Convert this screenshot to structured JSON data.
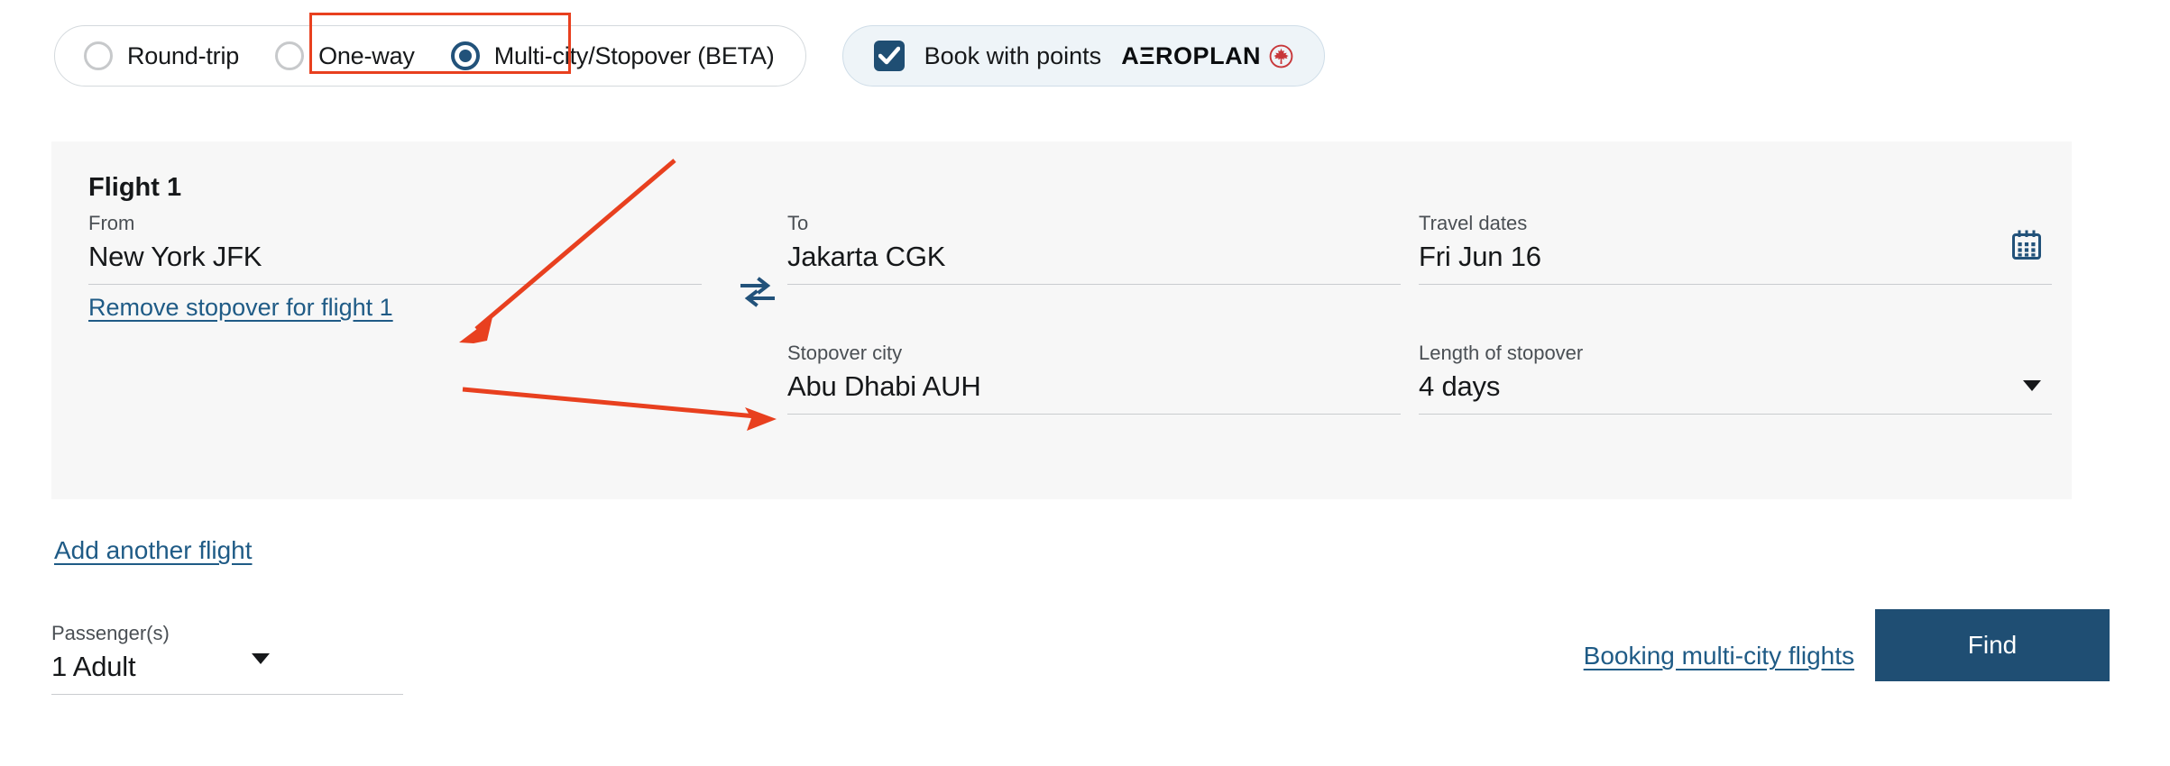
{
  "trip_types": {
    "options": [
      {
        "label": "Round-trip",
        "selected": false
      },
      {
        "label": "One-way",
        "selected": false
      },
      {
        "label": "Multi-city/Stopover (BETA)",
        "selected": true
      }
    ]
  },
  "points": {
    "label": "Book with points",
    "brand": "AΞROPLAN",
    "checked": true,
    "leaf_icon": "maple-leaf-roundel-icon"
  },
  "flight": {
    "title": "Flight 1",
    "from": {
      "label": "From",
      "value": "New York JFK"
    },
    "to": {
      "label": "To",
      "value": "Jakarta CGK"
    },
    "swap_icon": "swap-arrows-icon",
    "dates": {
      "label": "Travel dates",
      "value": "Fri Jun 16",
      "icon": "calendar-icon"
    },
    "remove_stopover_link": "Remove stopover for flight 1",
    "stopover_city": {
      "label": "Stopover city",
      "value": "Abu Dhabi AUH"
    },
    "stopover_length": {
      "label": "Length of stopover",
      "value": "4 days",
      "icon": "chevron-down-icon"
    }
  },
  "actions": {
    "add_another_flight": "Add another flight",
    "booking_help_link": "Booking multi-city flights",
    "find_label": "Find"
  },
  "passengers": {
    "label": "Passenger(s)",
    "value": "1 Adult",
    "icon": "chevron-down-icon"
  },
  "colors": {
    "brand_navy": "#1f4e73",
    "link_blue": "#1f5b86",
    "annotation_red": "#e8401f",
    "panel_bg": "#f7f7f7",
    "points_pill_bg": "#eef4f8"
  }
}
